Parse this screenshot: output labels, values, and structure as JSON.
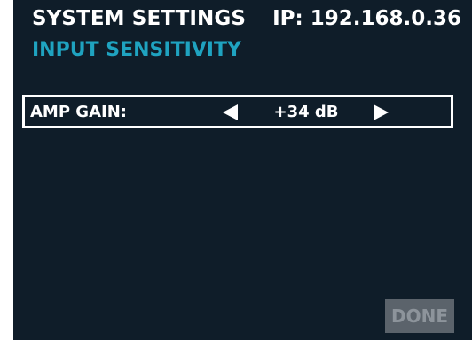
{
  "header": {
    "title": "SYSTEM SETTINGS",
    "ip": "IP: 192.168.0.36",
    "subtitle": "INPUT SENSITIVITY"
  },
  "setting": {
    "label": "AMP GAIN:",
    "value": "+34 dB",
    "decrement_icon": "left-triangle-icon",
    "increment_icon": "right-triangle-icon"
  },
  "footer": {
    "done_label": "DONE"
  },
  "colors": {
    "background": "#0f1d29",
    "accent": "#1fa3c0",
    "text": "#ffffff",
    "disabled_button_bg": "#5b636b",
    "disabled_button_text": "#8d949b"
  }
}
